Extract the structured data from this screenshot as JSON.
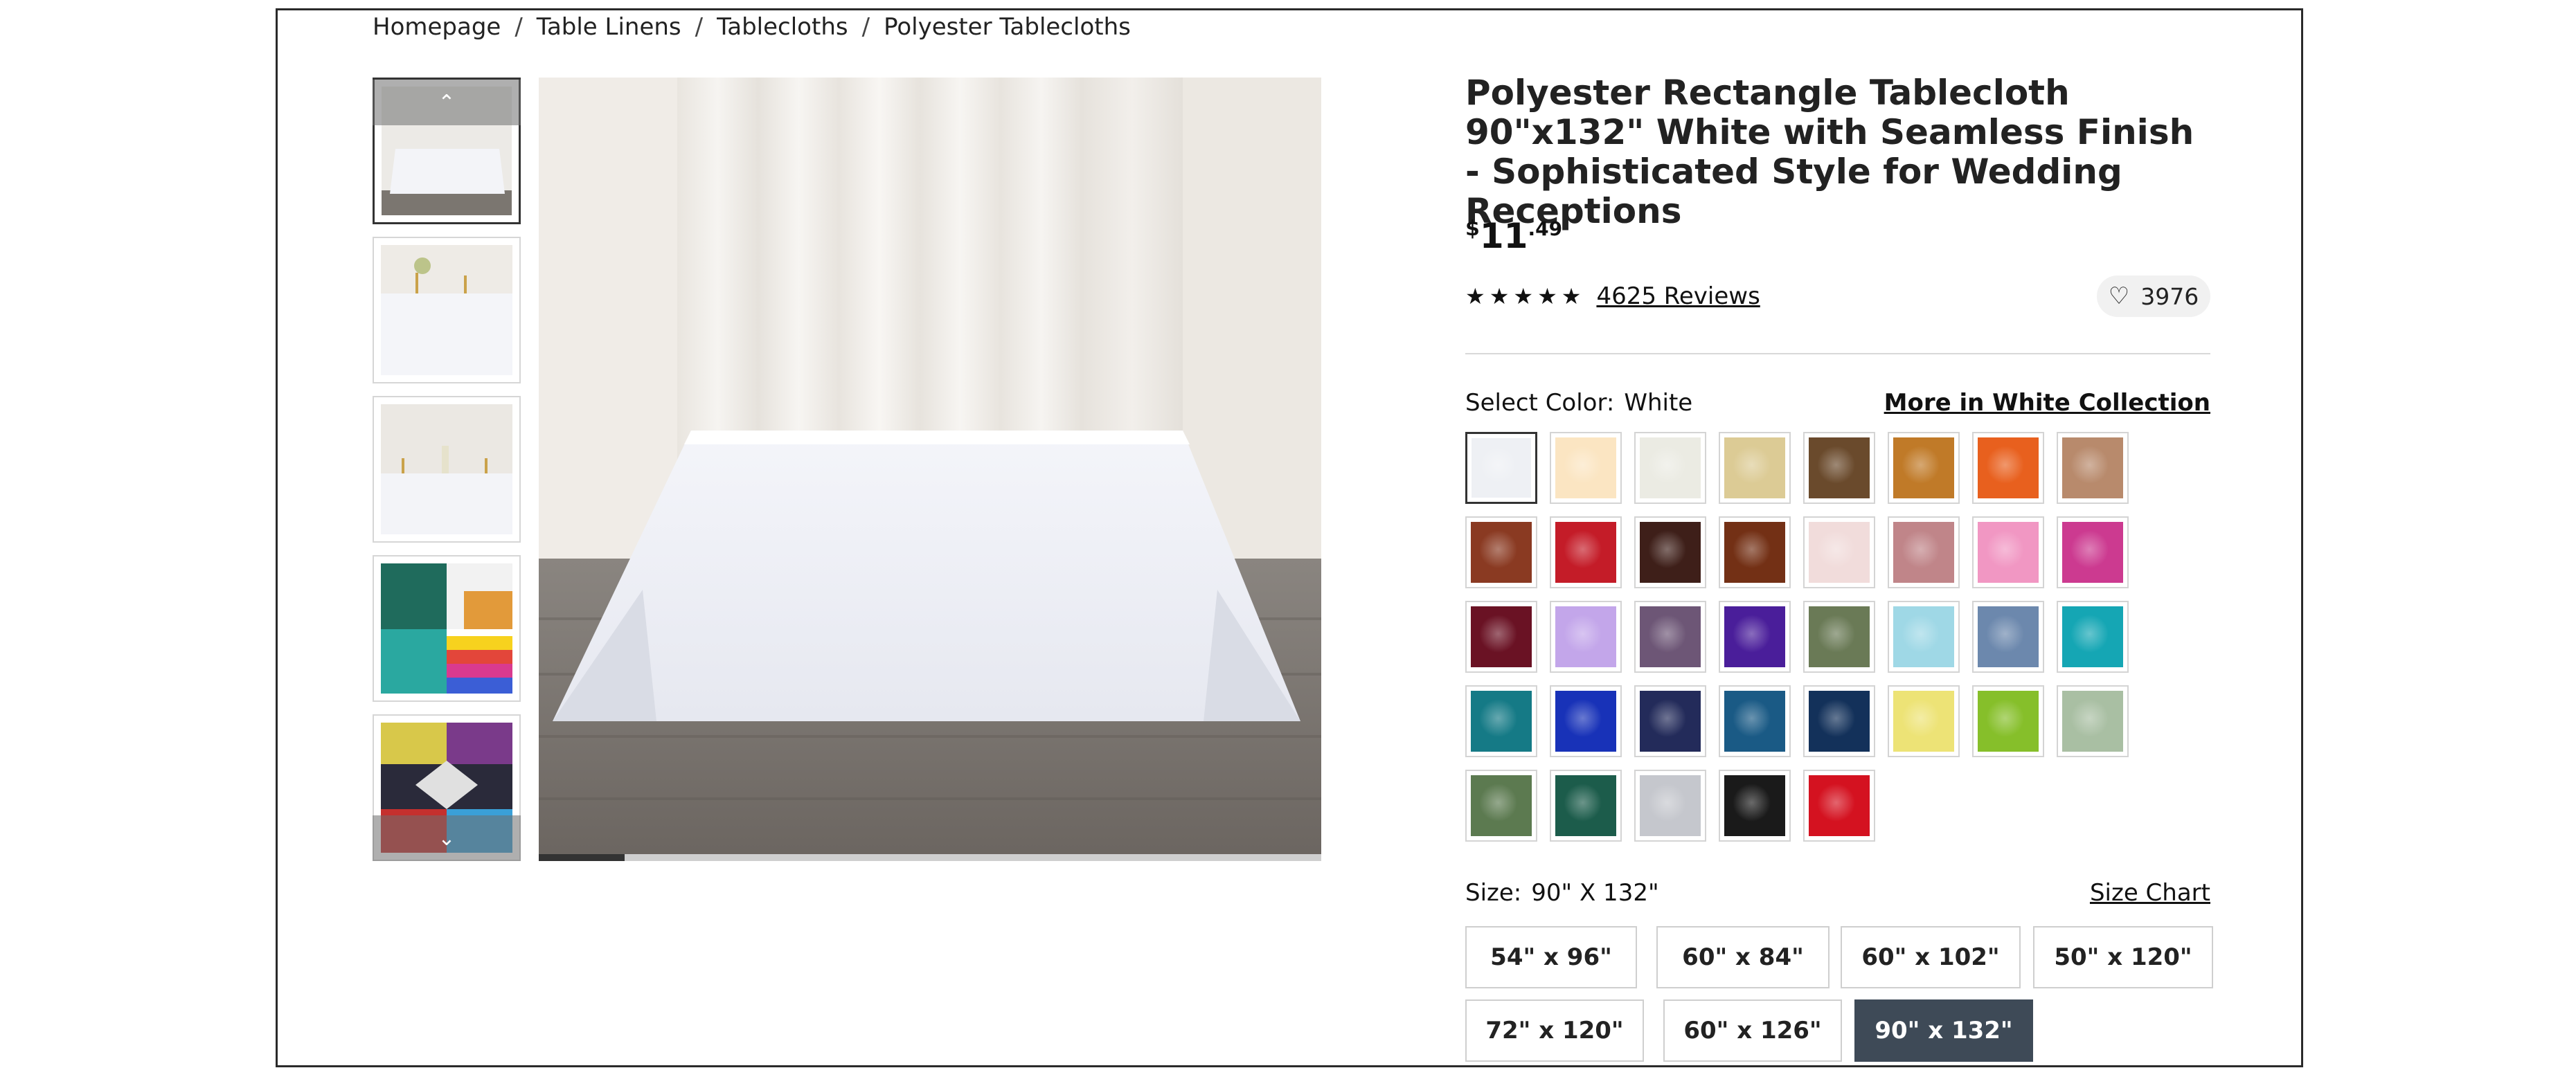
{
  "breadcrumb": {
    "items": [
      "Homepage",
      "Table Linens",
      "Tablecloths",
      "Polyester Tablecloths"
    ],
    "separator": "/"
  },
  "gallery": {
    "thumbnails": [
      "white tablecloth front view",
      "white tablecloth with candles",
      "white tablecloth with vases",
      "tablecloth color collage",
      "event tables collage"
    ],
    "nav_up_icon": "chevron-up-icon",
    "nav_down_icon": "chevron-down-icon",
    "progress": 0.11
  },
  "product": {
    "title": "Polyester Rectangle Tablecloth 90\"x132\" White with Seamless Finish - Sophisticated Style for Wedding Receptions",
    "price_currency": "$",
    "price_whole": "11",
    "price_cents": ".49",
    "rating_stars": 5,
    "reviews_label": "4625 Reviews",
    "wishlist_count": "3976"
  },
  "color": {
    "label": "Select Color:",
    "selected": "White",
    "more_link": "More in White Collection",
    "swatches": [
      "#eef0f4",
      "#fbe5c2",
      "#ebebe3",
      "#dccb95",
      "#6a4a2c",
      "#c07a28",
      "#e8601e",
      "#b88a6c",
      "#8a3a22",
      "#c41c28",
      "#3e1f19",
      "#733015",
      "#f1dcdb",
      "#c08589",
      "#f197c3",
      "#cc3a90",
      "#6a1224",
      "#c3a6ea",
      "#6d5676",
      "#4a1e9a",
      "#6a7a56",
      "#9fd8e6",
      "#6c88ad",
      "#15a6b4",
      "#157a86",
      "#1832b8",
      "#232b5a",
      "#1a5a85",
      "#13315a",
      "#ede376",
      "#86bf2a",
      "#a9bfa3",
      "#5c7a50",
      "#1c5c4b",
      "#c5c7cd",
      "#1a1a1a",
      "#d41220"
    ]
  },
  "size": {
    "label": "Size:",
    "selected": "90\" X 132\"",
    "chart_link": "Size Chart",
    "options": [
      "54\" x 96\"",
      "60\" x 84\"",
      "60\" x 102\"",
      "50\" x 120\"",
      "72\" x 120\"",
      "60\" x 126\"",
      "90\" x 132\""
    ],
    "selected_index": 6
  },
  "icons": {
    "star": "star-icon",
    "heart": "heart-icon"
  }
}
